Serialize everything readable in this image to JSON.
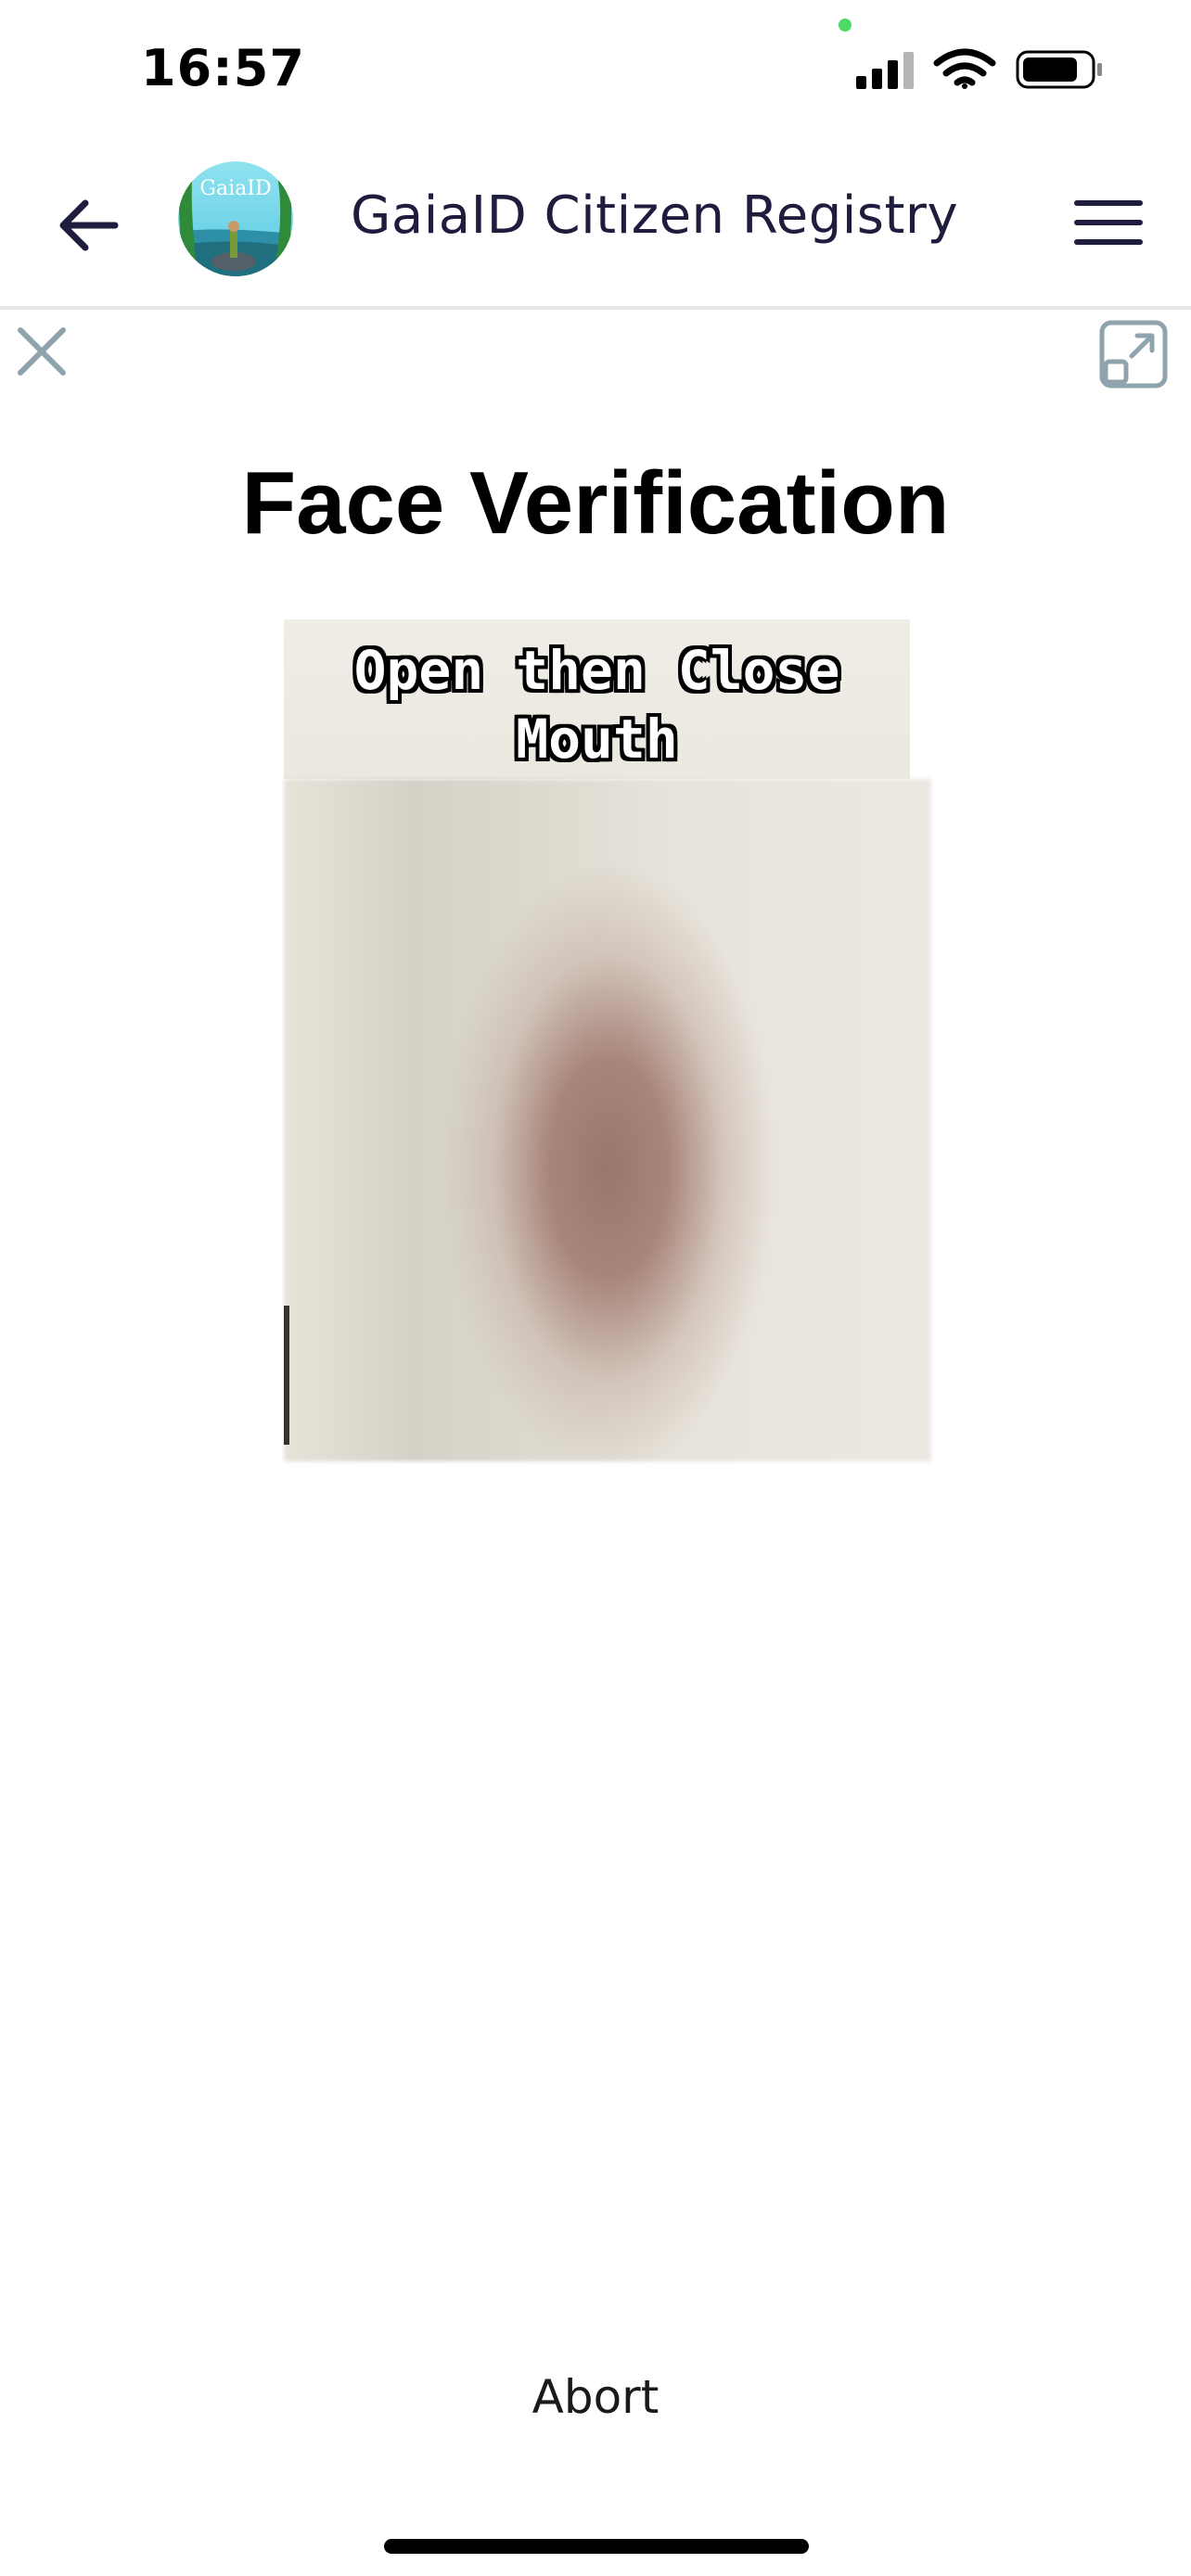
{
  "status_bar": {
    "time": "16:57",
    "icons": [
      "cellular-signal-icon",
      "wifi-icon",
      "battery-icon"
    ]
  },
  "header": {
    "title": "GaiaID Citizen Registry",
    "logo_text": "GaiaID",
    "back_icon": "arrow-left-icon",
    "menu_icon": "hamburger-menu-icon"
  },
  "toolbar": {
    "close_icon": "close-icon",
    "expand_icon": "open-external-icon"
  },
  "main": {
    "title": "Face Verification",
    "instruction_line1": "Open then Close",
    "instruction_line2": "Mouth",
    "abort_label": "Abort"
  },
  "colors": {
    "header_text": "#1f1d3d",
    "icon_gray": "#8fa3ad",
    "divider": "#e6e6e9",
    "privacy_dot": "#4cd964"
  }
}
